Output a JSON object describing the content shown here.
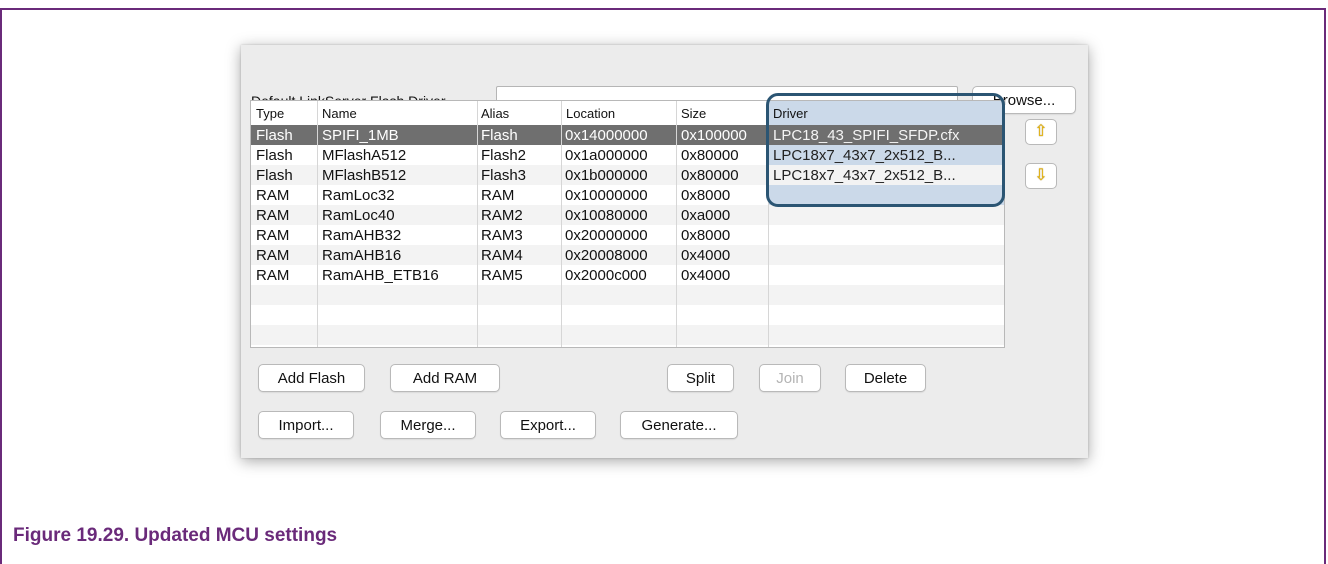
{
  "dialog": {
    "driver_label": "Default LinkServer Flash Driver",
    "driver_value": "",
    "browse_label": "Browse..."
  },
  "table": {
    "headers": [
      "Type",
      "Name",
      "Alias",
      "Location",
      "Size",
      "Driver"
    ],
    "rows": [
      {
        "type": "Flash",
        "name": "SPIFI_1MB",
        "alias": "Flash",
        "location": "0x14000000",
        "size": "0x100000",
        "driver": "LPC18_43_SPIFI_SFDP.cfx"
      },
      {
        "type": "Flash",
        "name": "MFlashA512",
        "alias": "Flash2",
        "location": "0x1a000000",
        "size": "0x80000",
        "driver": "LPC18x7_43x7_2x512_B..."
      },
      {
        "type": "Flash",
        "name": "MFlashB512",
        "alias": "Flash3",
        "location": "0x1b000000",
        "size": "0x80000",
        "driver": "LPC18x7_43x7_2x512_B..."
      },
      {
        "type": "RAM",
        "name": "RamLoc32",
        "alias": "RAM",
        "location": "0x10000000",
        "size": "0x8000",
        "driver": ""
      },
      {
        "type": "RAM",
        "name": "RamLoc40",
        "alias": "RAM2",
        "location": "0x10080000",
        "size": "0xa000",
        "driver": ""
      },
      {
        "type": "RAM",
        "name": "RamAHB32",
        "alias": "RAM3",
        "location": "0x20000000",
        "size": "0x8000",
        "driver": ""
      },
      {
        "type": "RAM",
        "name": "RamAHB16",
        "alias": "RAM4",
        "location": "0x20008000",
        "size": "0x4000",
        "driver": ""
      },
      {
        "type": "RAM",
        "name": "RamAHB_ETB16",
        "alias": "RAM5",
        "location": "0x2000c000",
        "size": "0x4000",
        "driver": ""
      }
    ],
    "selected_row": 0
  },
  "side_buttons": {
    "up_icon": "move-up-icon",
    "down_icon": "move-down-icon"
  },
  "buttons_row1": {
    "add_flash": "Add Flash",
    "add_ram": "Add RAM",
    "split": "Split",
    "join": "Join",
    "delete": "Delete"
  },
  "buttons_row2": {
    "import": "Import...",
    "merge": "Merge...",
    "export": "Export...",
    "generate": "Generate..."
  },
  "caption": "Figure 19.29. Updated MCU settings",
  "colors": {
    "accent": "#6a2a7a",
    "selection": "#6f6f6f",
    "driver_highlight": "#cbd9e9",
    "outline": "#2b5573"
  }
}
